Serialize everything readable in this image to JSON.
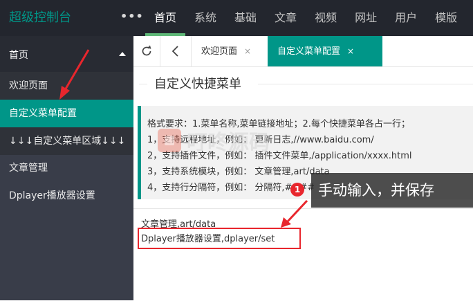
{
  "app": {
    "title": "超级控制台",
    "more": "•••"
  },
  "topnav": [
    "首页",
    "系统",
    "基础",
    "文章",
    "视频",
    "网址",
    "用户",
    "模版"
  ],
  "sidebar": {
    "group": "首页",
    "items": [
      "欢迎页面",
      "自定义菜单配置",
      "↓↓↓自定义菜单区域↓↓↓"
    ],
    "extra": [
      "文章管理",
      "Dplayer播放器设置"
    ]
  },
  "tabs": [
    {
      "label": "欢迎页面",
      "close": "×"
    },
    {
      "label": "自定义菜单配置",
      "close": "×"
    }
  ],
  "page": {
    "legend": "自定义快捷菜单",
    "notice": [
      "格式要求：1.菜单名称,菜单链接地址；2.每个快捷菜单各占一行；",
      "1，支持远程地址，例如：   更新日志,//www.baidu.com/",
      "2，支持插件文件，例如：   插件文件菜单,/application/xxxx.html",
      "3，支持系统模块，例如：   文章管理,art/data",
      "4，支持行分隔符，例如：   分隔符,####"
    ],
    "textarea_lines": [
      "文章管理,art/data",
      "Dplayer播放器设置,dplayer/set"
    ]
  },
  "annotation": {
    "badge": "1",
    "callout": "手动输入，并保存"
  },
  "colors": {
    "accent": "#009688",
    "topbar": "#23262e",
    "sidebar": "#393d49",
    "annotation": "#e8262d"
  }
}
